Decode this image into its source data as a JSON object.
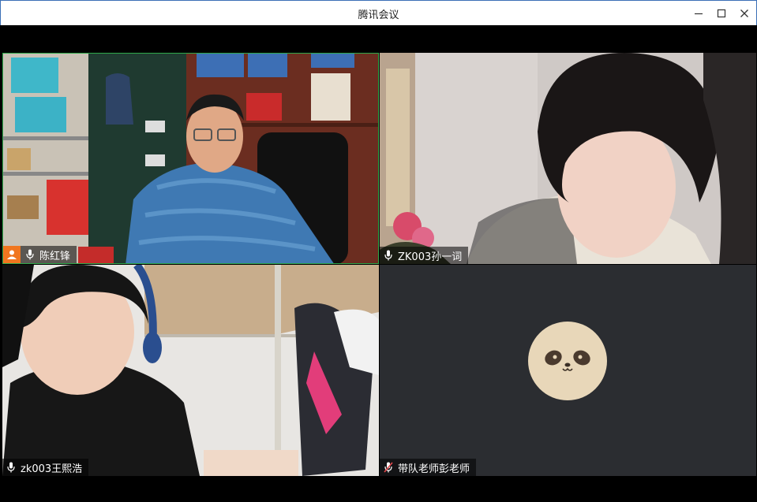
{
  "window": {
    "title": "腾讯会议",
    "controls": [
      "minimize-icon",
      "maximize-icon",
      "close-icon"
    ]
  },
  "participants": [
    {
      "name": "陈红锋",
      "role": "host",
      "mic": "on",
      "icon": "mic-icon"
    },
    {
      "name": "ZK003孙一词",
      "mic": "on",
      "icon": "mic-icon"
    },
    {
      "name": "zk003王熙浩",
      "mic": "on",
      "icon": "mic-icon"
    },
    {
      "name": "带队老师彭老师",
      "mic": "muted",
      "icon": "mic-muted-icon",
      "video": "off",
      "avatar": "panda-avatar-icon"
    }
  ],
  "colors": {
    "active_speaker_border": "#2ea84a",
    "host_badge": "#f0761f",
    "muted_mic": "#e5484d",
    "video_off_bg": "#2b2d31"
  }
}
